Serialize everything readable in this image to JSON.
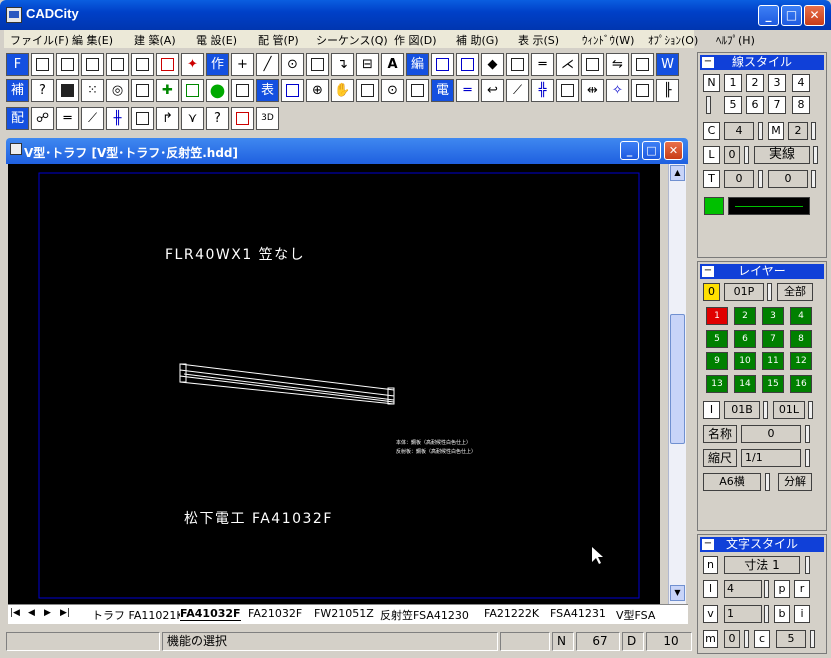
{
  "app": {
    "title": "CADCity"
  },
  "menu": [
    "ファイル(F)",
    "編 集(E)",
    "建 築(A)",
    "電 設(E)",
    "配 管(P)",
    "シーケンス(Q)",
    "作 図(D)",
    "補 助(G)",
    "表 示(S)",
    "ｳｨﾝﾄﾞｳ(W)",
    "ｵﾌﾟｼｮﾝ(O)",
    "ﾍﾙﾌﾟ(H)"
  ],
  "toolbar": {
    "r1_f": "F",
    "r1_saku": "作",
    "r1_plus": "+",
    "r1_a": "A",
    "r1_hen": "編",
    "r1_w": "W",
    "r2_ho": "補",
    "r2_hyo": "表",
    "r2_den": "電",
    "r3_hai": "配"
  },
  "document": {
    "title": "V型･トラフ [V型･トラフ･反射笠.hdd]"
  },
  "drawing": {
    "title_text": "FLR40WX1 笠なし",
    "note1": "本体：鋼板（高耐候性白色仕上）",
    "note2": "反射板：鋼板（高耐候性白色仕上）",
    "label": "松下電工 FA41032F"
  },
  "tabs": [
    "トラフ FA11021K",
    "FA41032F",
    "FA21032F",
    "FW21051Z",
    "反射笠FSA41230",
    "FA21222K",
    "FSA41231",
    "V型FSA"
  ],
  "status": {
    "message": "機能の選択",
    "n_label": "N",
    "n_value": "67",
    "d_label": "D",
    "d_value": "10"
  },
  "line_style": {
    "title": "線スタイル",
    "n_label": "N",
    "nums": [
      "1",
      "2",
      "3",
      "4",
      "5",
      "6",
      "7",
      "8"
    ],
    "c_label": "C",
    "c_value": "4",
    "m_label": "M",
    "m_value": "2",
    "l_label": "L",
    "l_value": "0",
    "line_type": "実線",
    "t_label": "T",
    "t_value1": "0",
    "t_value2": "0",
    "color": "#00c000"
  },
  "layer": {
    "title": "レイヤー",
    "current": "0",
    "group": "01P",
    "all_label": "全部",
    "layers": [
      "1",
      "2",
      "3",
      "4",
      "5",
      "6",
      "7",
      "8",
      "9",
      "10",
      "11",
      "12",
      "13",
      "14",
      "15",
      "16"
    ],
    "i_label": "I",
    "i_value1": "01B",
    "i_value2": "01L",
    "name_label": "名称",
    "name_value": "0",
    "scale_label": "縮尺",
    "scale_value": "1/1",
    "paper": "A6横",
    "decompose": "分解"
  },
  "text_style": {
    "title": "文字スタイル",
    "n_label": "n",
    "n_value": "寸法 1",
    "l_label": "l",
    "l_value": "4",
    "p_label": "p",
    "r_label": "r",
    "v_label": "v",
    "v_value": "1",
    "b_label": "b",
    "i_label": "i",
    "m_label": "m",
    "m_value": "0",
    "c_label": "c",
    "c_value": "5"
  }
}
